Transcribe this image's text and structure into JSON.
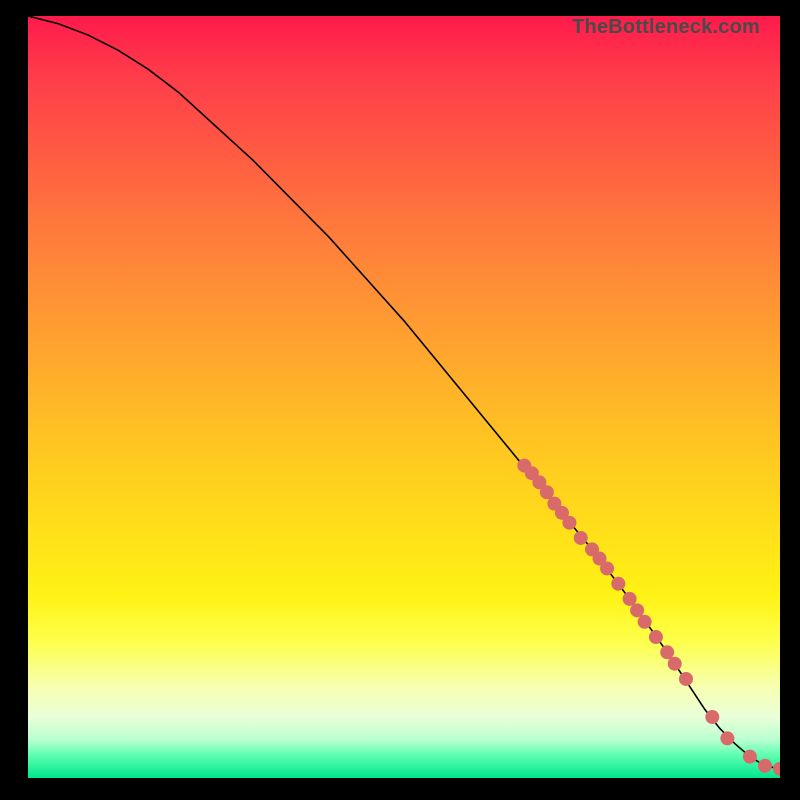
{
  "watermark": "TheBottleneck.com",
  "chart_data": {
    "type": "line",
    "title": "",
    "xlabel": "",
    "ylabel": "",
    "xlim": [
      0,
      100
    ],
    "ylim": [
      0,
      100
    ],
    "curve": {
      "x": [
        0,
        4,
        8,
        12,
        16,
        20,
        25,
        30,
        35,
        40,
        45,
        50,
        55,
        60,
        65,
        70,
        75,
        80,
        85,
        88,
        90,
        92,
        94,
        96,
        98,
        100
      ],
      "y": [
        100,
        99,
        97.5,
        95.5,
        93,
        90,
        85.5,
        81,
        76,
        71,
        65.5,
        60,
        54,
        48,
        42,
        36,
        30,
        23.5,
        16.5,
        12,
        9,
        6.5,
        4.5,
        2.8,
        1.6,
        1.2
      ]
    },
    "markers": {
      "x": [
        66,
        67,
        68,
        69,
        70,
        71,
        72,
        73.5,
        75,
        76,
        77,
        78.5,
        80,
        81,
        82,
        83.5,
        85,
        86,
        87.5,
        91,
        93,
        96,
        98,
        100
      ],
      "y": [
        41,
        40,
        38.8,
        37.5,
        36,
        34.8,
        33.5,
        31.5,
        30,
        28.8,
        27.5,
        25.5,
        23.5,
        22,
        20.5,
        18.5,
        16.5,
        15,
        13,
        8,
        5.2,
        2.8,
        1.6,
        1.2
      ],
      "r": 7
    },
    "gradient_stops": [
      {
        "offset": 0.0,
        "color": "#ff1a4b"
      },
      {
        "offset": 0.5,
        "color": "#ffca20"
      },
      {
        "offset": 0.8,
        "color": "#fdff4a"
      },
      {
        "offset": 1.0,
        "color": "#00e78b"
      }
    ]
  }
}
